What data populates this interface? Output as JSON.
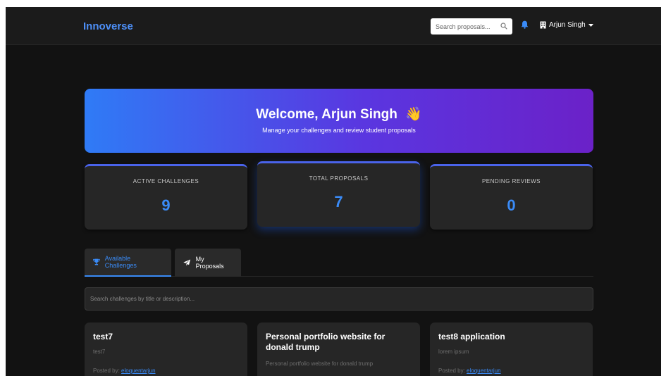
{
  "navbar": {
    "brand": "Innoverse",
    "search_placeholder": "Search proposals...",
    "user_name": "Arjun Singh"
  },
  "hero": {
    "title": "Welcome, Arjun Singh",
    "wave_emoji": "👋",
    "subtitle": "Manage your challenges and review student proposals"
  },
  "stats": [
    {
      "label": "ACTIVE CHALLENGES",
      "value": "9"
    },
    {
      "label": "TOTAL PROPOSALS",
      "value": "7"
    },
    {
      "label": "PENDING REVIEWS",
      "value": "0"
    }
  ],
  "tabs": [
    {
      "label": "Available Challenges",
      "icon": "trophy-icon",
      "active": true
    },
    {
      "label": "My Proposals",
      "icon": "paper-plane-icon",
      "active": false
    }
  ],
  "challenge_search_placeholder": "Search challenges by title or description...",
  "posted_by_label": "Posted by:",
  "challenges": [
    {
      "title": "test7",
      "description": "test7",
      "author": "eloquentarjun"
    },
    {
      "title": "Personal portfolio website for donald trump",
      "description": "Personal portfolio website for donald trump",
      "author": ""
    },
    {
      "title": "test8 application",
      "description": "lorem ipsum",
      "author": "eloquentarjun"
    }
  ],
  "colors": {
    "accent": "#3a8bf7",
    "background": "#121212",
    "card": "#262626",
    "hero_gradient_start": "#2f7bf6",
    "hero_gradient_end": "#6b21c8"
  }
}
